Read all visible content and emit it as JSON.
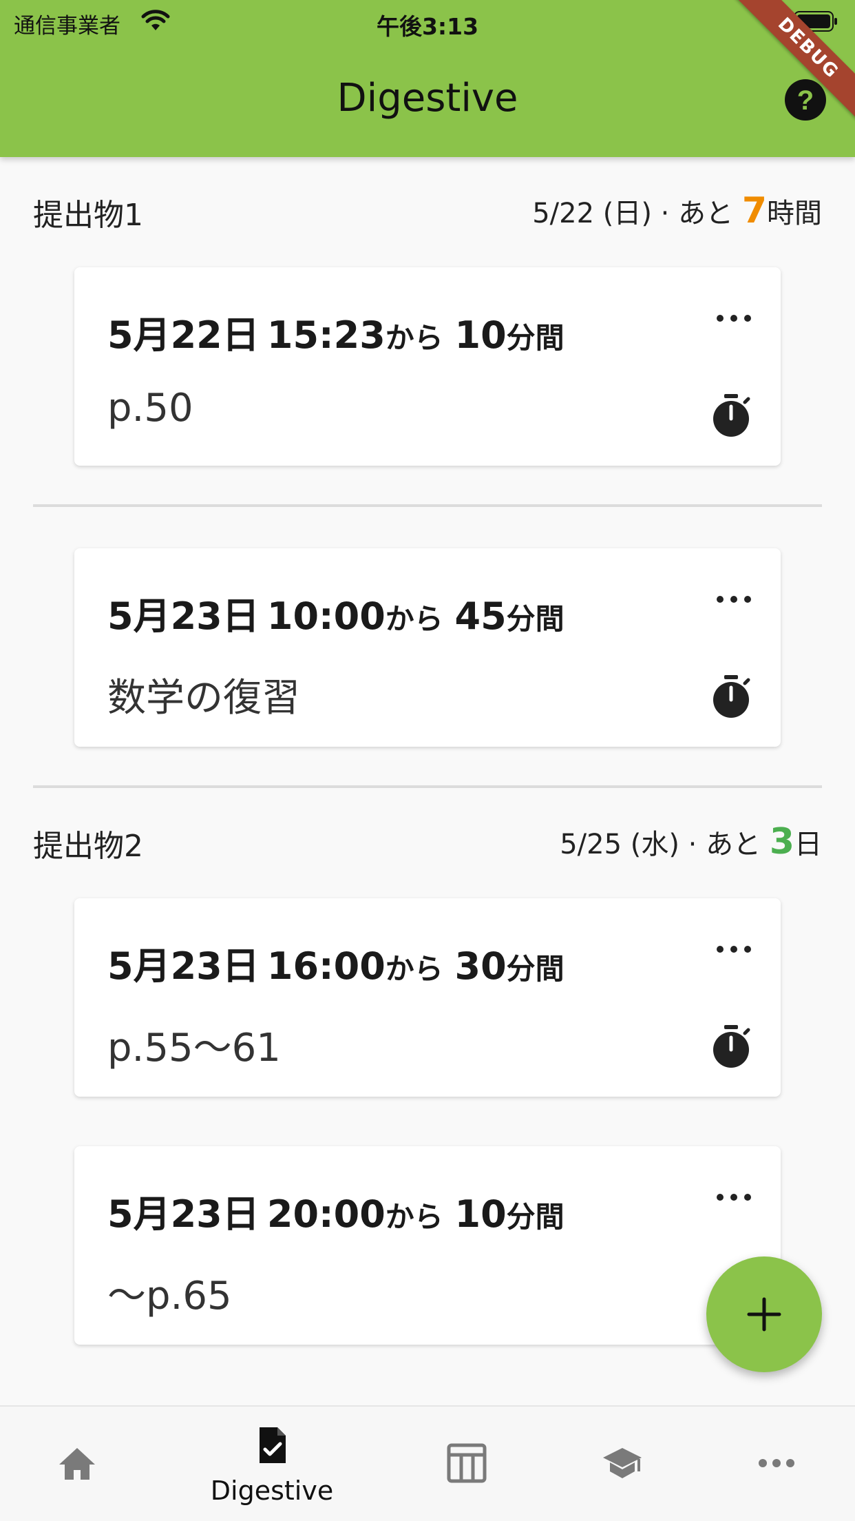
{
  "status_bar": {
    "carrier": "通信事業者",
    "time": "午後3:13"
  },
  "header": {
    "title": "Digestive",
    "debug_label": "DEBUG"
  },
  "sections": [
    {
      "title": "提出物1",
      "due_date": "5/22 (日) · あと",
      "remaining_value": "7",
      "remaining_unit": "時間",
      "sessions": [
        {
          "date": "5月22日",
          "start_time": "15:23",
          "start_suffix": "から",
          "duration_value": "10",
          "duration_unit": "分間",
          "task": "p.50"
        },
        {
          "date": "5月23日",
          "start_time": "10:00",
          "start_suffix": "から",
          "duration_value": "45",
          "duration_unit": "分間",
          "task": "数学の復習"
        }
      ]
    },
    {
      "title": "提出物2",
      "due_date": "5/25 (水) · あと",
      "remaining_value": "3",
      "remaining_unit": "日",
      "sessions": [
        {
          "date": "5月23日",
          "start_time": "16:00",
          "start_suffix": "から",
          "duration_value": "30",
          "duration_unit": "分間",
          "task": "p.55〜61"
        },
        {
          "date": "5月23日",
          "start_time": "20:00",
          "start_suffix": "から",
          "duration_value": "10",
          "duration_unit": "分間",
          "task": "〜p.65"
        }
      ]
    }
  ],
  "bottom_nav": {
    "items": [
      {
        "icon": "home-icon",
        "label": ""
      },
      {
        "icon": "assignment-check-icon",
        "label": "Digestive"
      },
      {
        "icon": "timetable-icon",
        "label": ""
      },
      {
        "icon": "school-icon",
        "label": ""
      },
      {
        "icon": "more-horiz-icon",
        "label": ""
      }
    ],
    "active_index": 1
  },
  "colors": {
    "primary": "#8bc34a",
    "remaining_hours": "#f08c00",
    "remaining_days": "#4caf50",
    "debug_ribbon": "#a5442e"
  }
}
